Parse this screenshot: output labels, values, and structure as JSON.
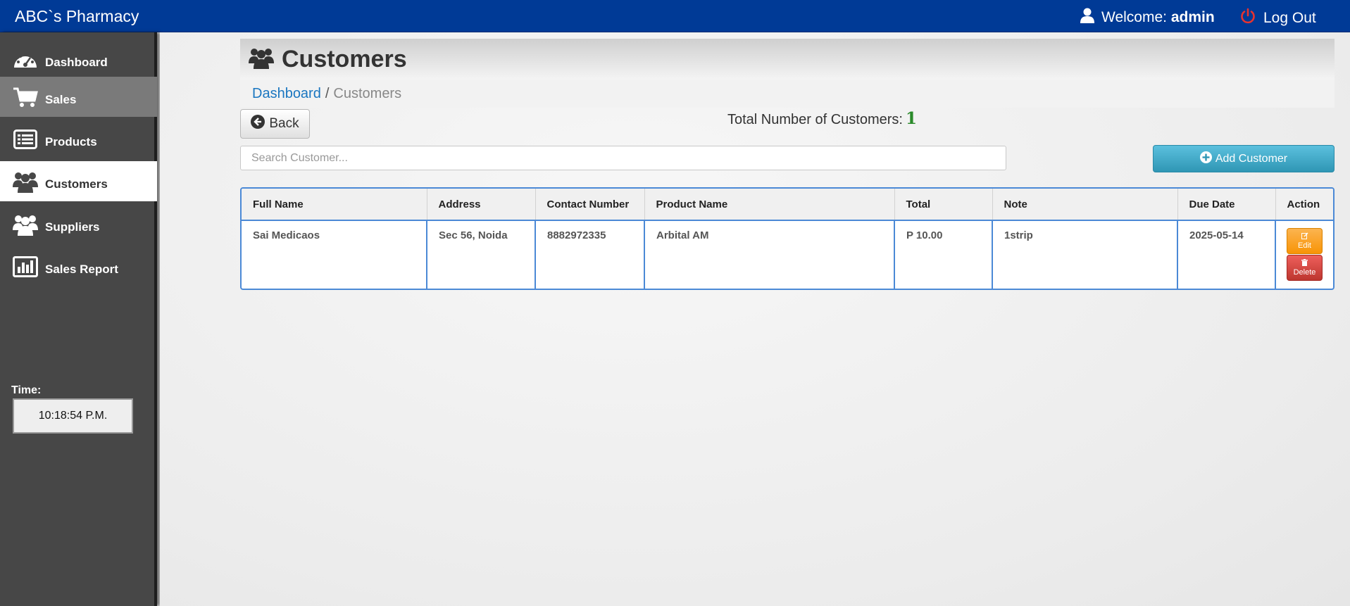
{
  "app": {
    "brand": "ABC`s Pharmacy",
    "welcome_prefix": "Welcome:",
    "user": "admin",
    "logout_label": "Log Out"
  },
  "sidebar": {
    "items": [
      {
        "label": "Dashboard",
        "icon": "dashboard-gauge-icon"
      },
      {
        "label": "Sales",
        "icon": "cart-icon"
      },
      {
        "label": "Products",
        "icon": "list-icon"
      },
      {
        "label": "Customers",
        "icon": "users-icon"
      },
      {
        "label": "Suppliers",
        "icon": "users-icon"
      },
      {
        "label": "Sales Report",
        "icon": "bar-chart-icon"
      }
    ],
    "time_label": "Time:",
    "time_value": "10:18:54 P.M."
  },
  "page": {
    "title": "Customers",
    "breadcrumb": {
      "link": "Dashboard",
      "separator": "/",
      "current": "Customers"
    },
    "back_label": "Back",
    "total_label": "Total Number of Customers:",
    "total_count": "1",
    "search_placeholder": "Search Customer...",
    "add_label": "Add Customer"
  },
  "table": {
    "headers": [
      "Full Name",
      "Address",
      "Contact Number",
      "Product Name",
      "Total",
      "Note",
      "Due Date",
      "Action"
    ],
    "rows": [
      {
        "full_name": "Sai Medicaos",
        "address": "Sec 56, Noida",
        "contact": "8882972335",
        "product": "Arbital AM",
        "total": "P 10.00",
        "note": "1strip",
        "due_date": "2025-05-14",
        "edit_label": "Edit",
        "delete_label": "Delete"
      }
    ]
  },
  "colors": {
    "topbar": "#003a96",
    "sidebar": "#474747",
    "accent_info": "#5bc0de",
    "edit": "#f89406",
    "delete": "#bd362f",
    "count_green": "#2a8a2a"
  }
}
